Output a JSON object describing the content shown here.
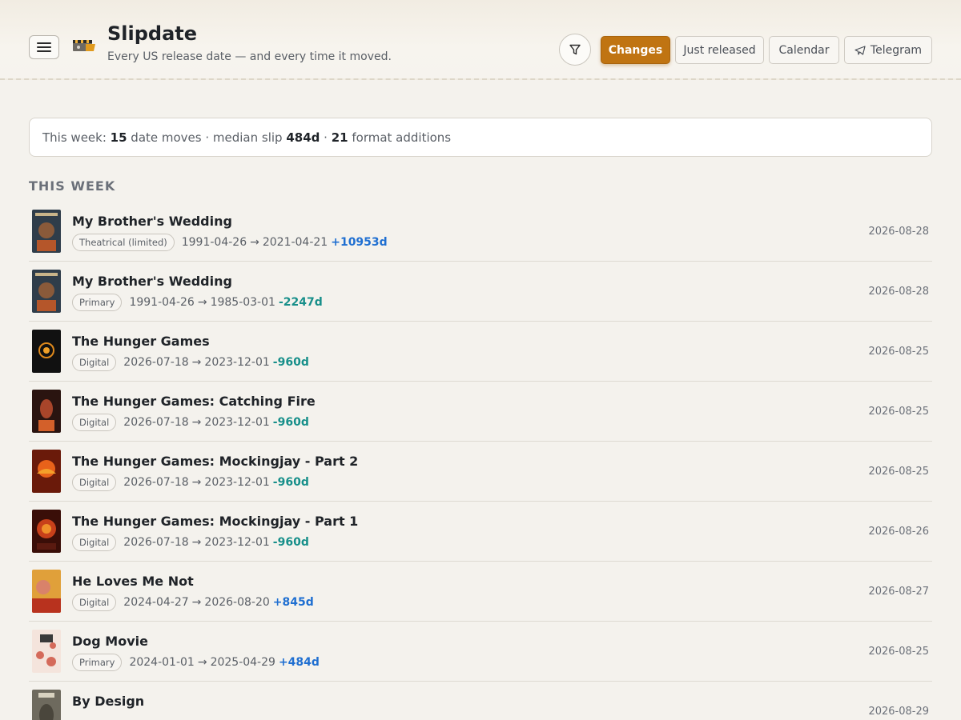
{
  "app": {
    "title": "Slipdate",
    "subtitle": "Every US release date — and every time it moved."
  },
  "nav": {
    "changes": "Changes",
    "just_released": "Just released",
    "calendar": "Calendar",
    "telegram": "Telegram"
  },
  "summary": {
    "prefix": "This week: ",
    "date_moves": "15",
    "date_moves_label": " date moves · median slip ",
    "median_slip": "484d",
    "sep": " · ",
    "format_additions": "21",
    "format_additions_label": " format additions"
  },
  "section": {
    "heading": "THIS WEEK"
  },
  "colors": {
    "accent": "#c07412",
    "positive_delta": "#1f6fd1",
    "negative_delta": "#178f8a"
  },
  "icons": {
    "menu": "hamburger-menu-icon",
    "logo": "clapperboard-logo-icon",
    "filter": "funnel-icon",
    "telegram": "paper-plane-icon"
  },
  "rows": [
    {
      "title": "My Brother's Wedding",
      "format": "Theatrical (limited)",
      "from": "1991-04-26",
      "arrow": "→",
      "to": "2021-04-21",
      "delta": "+10953d",
      "date": "2026-08-28"
    },
    {
      "title": "My Brother's Wedding",
      "format": "Primary",
      "from": "1991-04-26",
      "arrow": "→",
      "to": "1985-03-01",
      "delta": "-2247d",
      "date": "2026-08-28"
    },
    {
      "title": "The Hunger Games",
      "format": "Digital",
      "from": "2026-07-18",
      "arrow": "→",
      "to": "2023-12-01",
      "delta": "-960d",
      "date": "2026-08-25"
    },
    {
      "title": "The Hunger Games: Catching Fire",
      "format": "Digital",
      "from": "2026-07-18",
      "arrow": "→",
      "to": "2023-12-01",
      "delta": "-960d",
      "date": "2026-08-25"
    },
    {
      "title": "The Hunger Games: Mockingjay - Part 2",
      "format": "Digital",
      "from": "2026-07-18",
      "arrow": "→",
      "to": "2023-12-01",
      "delta": "-960d",
      "date": "2026-08-25"
    },
    {
      "title": "The Hunger Games: Mockingjay - Part 1",
      "format": "Digital",
      "from": "2026-07-18",
      "arrow": "→",
      "to": "2023-12-01",
      "delta": "-960d",
      "date": "2026-08-26"
    },
    {
      "title": "He Loves Me Not",
      "format": "Digital",
      "from": "2024-04-27",
      "arrow": "→",
      "to": "2026-08-20",
      "delta": "+845d",
      "date": "2026-08-27"
    },
    {
      "title": "Dog Movie",
      "format": "Primary",
      "from": "2024-01-01",
      "arrow": "→",
      "to": "2025-04-29",
      "delta": "+484d",
      "date": "2026-08-25"
    },
    {
      "title": "By Design",
      "format": "",
      "from": "",
      "arrow": "",
      "to": "",
      "delta": "",
      "date": "2026-08-29"
    }
  ]
}
